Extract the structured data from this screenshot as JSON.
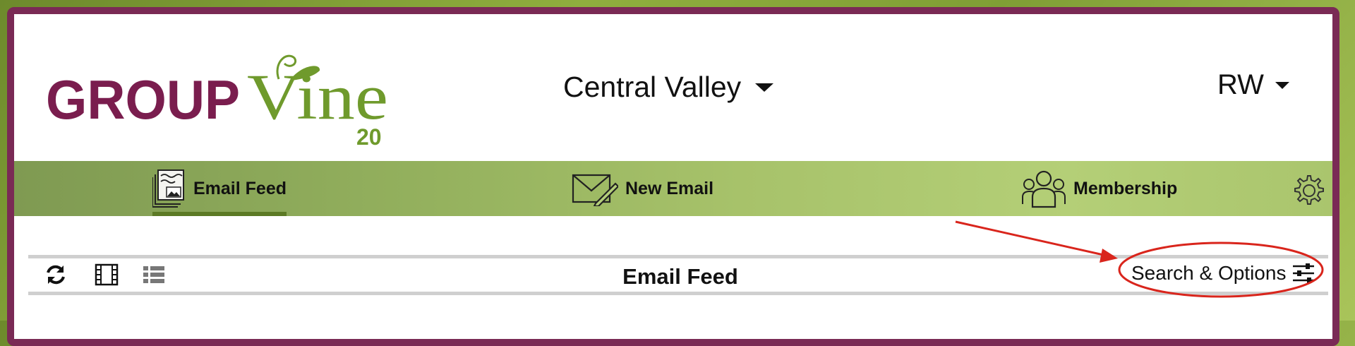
{
  "logo": {
    "brand_left": "GROUP",
    "brand_right": "Vine",
    "edition": "20"
  },
  "header": {
    "group_name": "Central Valley",
    "user_initials": "RW"
  },
  "nav": {
    "email_feed": "Email Feed",
    "new_email": "New Email",
    "membership": "Membership"
  },
  "toolbar": {
    "title": "Email Feed",
    "search_options": "Search & Options"
  },
  "colors": {
    "brand_maroon": "#7a2a55",
    "brand_green": "#6f9a2c",
    "annotation_red": "#d9251c"
  },
  "icons": [
    "refresh-icon",
    "film-view-icon",
    "list-view-icon",
    "sliders-icon",
    "gear-icon",
    "envelope-pen-icon",
    "people-icon",
    "email-feed-icon"
  ]
}
